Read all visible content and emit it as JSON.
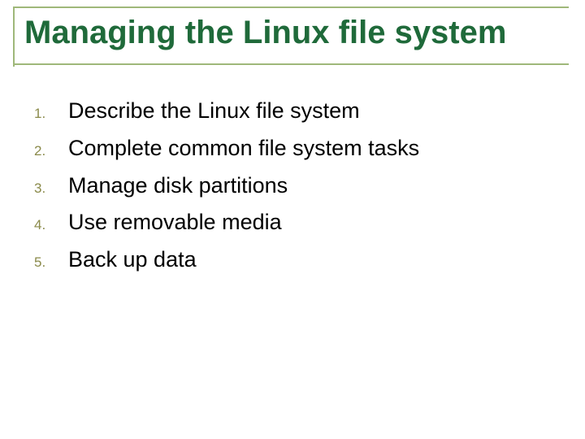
{
  "slide": {
    "title": "Managing the Linux file system",
    "items": [
      {
        "num": "1.",
        "text": "Describe the Linux file system"
      },
      {
        "num": "2.",
        "text": "Complete common file system tasks"
      },
      {
        "num": "3.",
        "text": "Manage disk partitions"
      },
      {
        "num": "4.",
        "text": "Use removable media"
      },
      {
        "num": "5.",
        "text": "Back up data"
      }
    ]
  }
}
